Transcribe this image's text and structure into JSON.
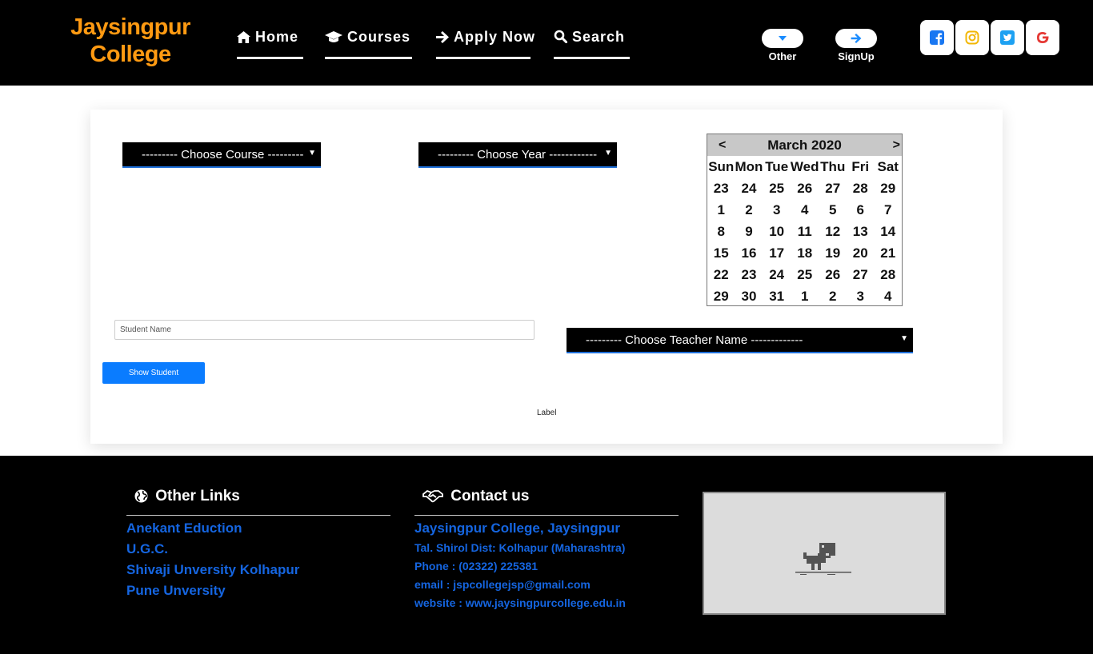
{
  "header": {
    "logo_line1": "Jaysingpur",
    "logo_line2": "College",
    "nav": [
      {
        "label": "Home",
        "icon": "home-icon"
      },
      {
        "label": "Courses",
        "icon": "graduation-cap-icon"
      },
      {
        "label": "Apply Now",
        "icon": "arrow-right-icon"
      },
      {
        "label": "Search",
        "icon": "search-icon"
      }
    ],
    "other_label": "Other",
    "signup_label": "SignUp",
    "social": [
      "facebook-icon",
      "instagram-icon",
      "twitter-icon",
      "google-icon"
    ]
  },
  "form": {
    "course_select": "--------- Choose Course ---------",
    "year_select": "--------- Choose Year ------------",
    "teacher_select": "--------- Choose Teacher Name -------------",
    "student_placeholder": "Student Name",
    "show_button": "Show Student",
    "label": "Label"
  },
  "calendar": {
    "prev": "<",
    "next": ">",
    "month_year": "March 2020",
    "weekdays": [
      "Sun",
      "Mon",
      "Tue",
      "Wed",
      "Thu",
      "Fri",
      "Sat"
    ],
    "days": [
      "23",
      "24",
      "25",
      "26",
      "27",
      "28",
      "29",
      "1",
      "2",
      "3",
      "4",
      "5",
      "6",
      "7",
      "8",
      "9",
      "10",
      "11",
      "12",
      "13",
      "14",
      "15",
      "16",
      "17",
      "18",
      "19",
      "20",
      "21",
      "22",
      "23",
      "24",
      "25",
      "26",
      "27",
      "28",
      "29",
      "30",
      "31",
      "1",
      "2",
      "3",
      "4"
    ]
  },
  "footer": {
    "links_title": "Other Links",
    "links": [
      "Anekant Eduction",
      "U.G.C.",
      "Shivaji Unversity Kolhapur",
      "Pune Unversity"
    ],
    "contact_title": "Contact us",
    "contact_name": "Jaysingpur College, Jaysingpur",
    "contact_address": "Tal. Shirol Dist: Kolhapur (Maharashtra)",
    "contact_phone": "Phone : (02322) 225381",
    "contact_email": "email : jspcollegejsp@gmail.com",
    "contact_website": "website : www.jaysingpurcollege.edu.in"
  },
  "colors": {
    "logo": "#ff9a12",
    "link": "#1565e0",
    "button": "#0a7cff"
  }
}
